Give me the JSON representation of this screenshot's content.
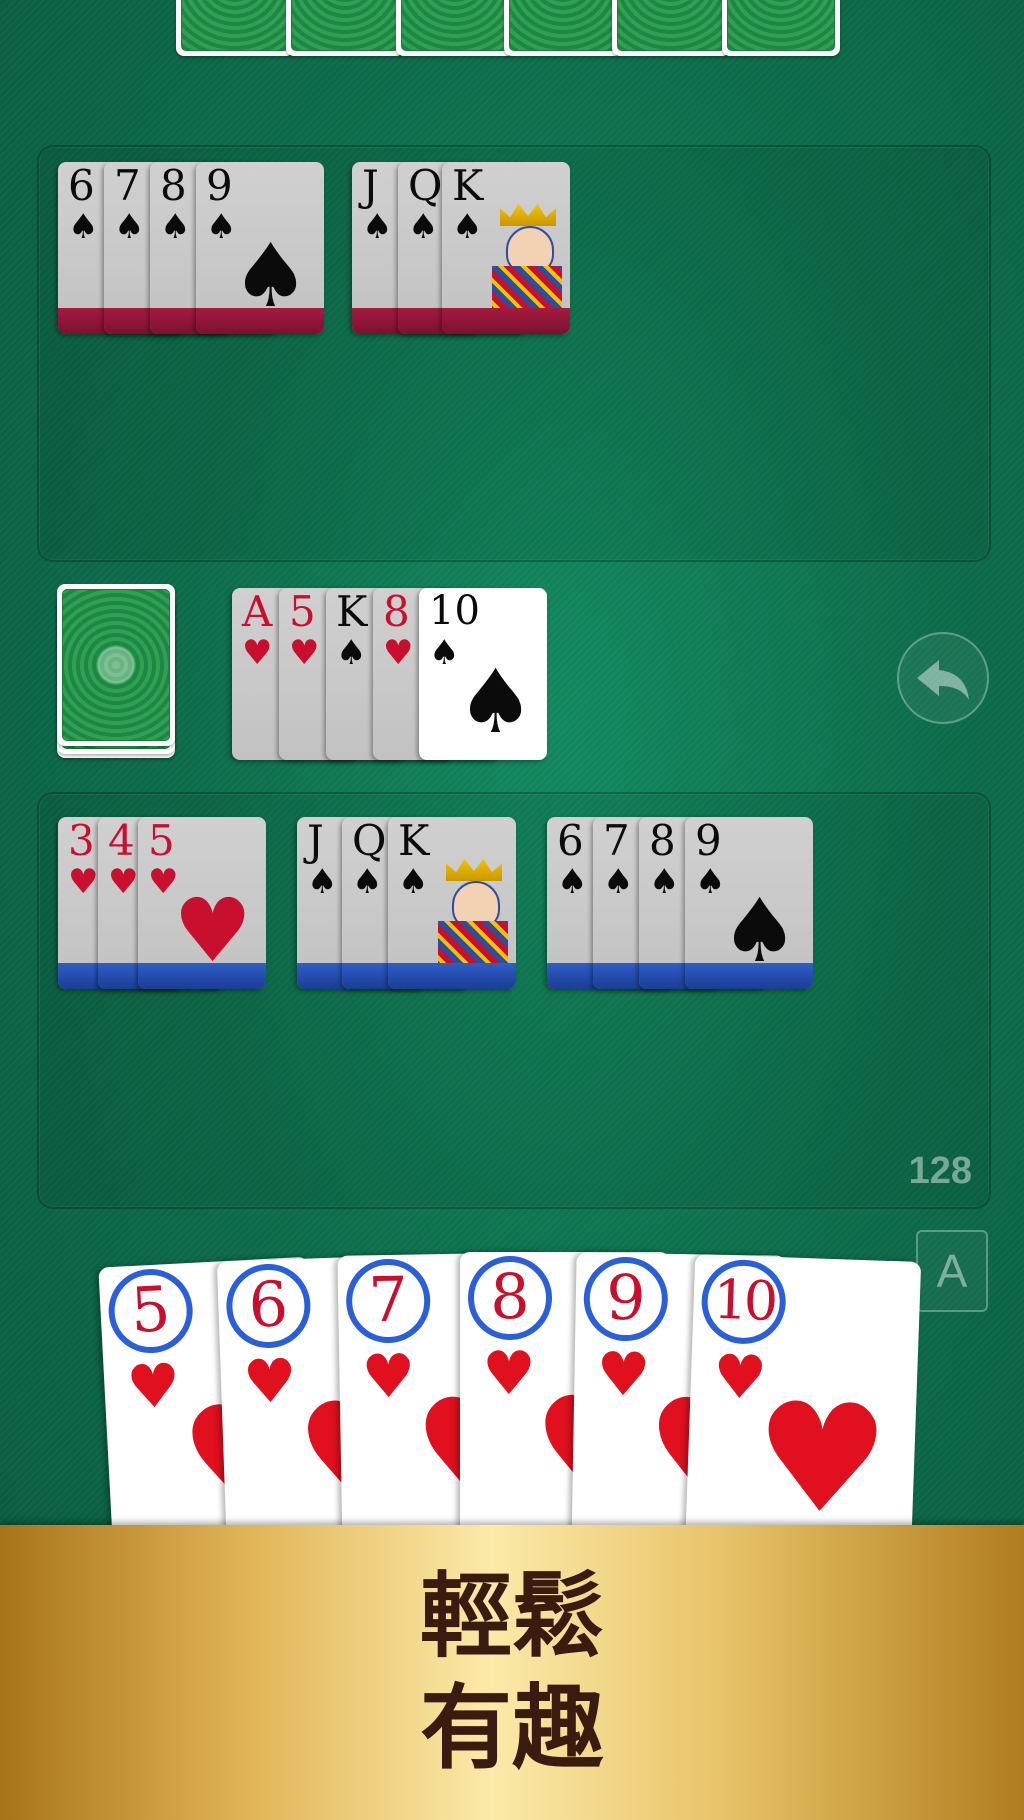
{
  "opponent": {
    "hidden_card_count": 6,
    "melds": [
      {
        "ranks": [
          "6",
          "7",
          "8",
          "9"
        ],
        "suit": "♠",
        "color": "black"
      },
      {
        "ranks": [
          "J",
          "Q",
          "K"
        ],
        "suit": "♠",
        "color": "black"
      }
    ]
  },
  "discard_pile": [
    {
      "rank": "A",
      "suit": "♥",
      "color": "red"
    },
    {
      "rank": "5",
      "suit": "♥",
      "color": "red"
    },
    {
      "rank": "K",
      "suit": "♠",
      "color": "black"
    },
    {
      "rank": "8",
      "suit": "♥",
      "color": "red"
    },
    {
      "rank": "10",
      "suit": "♠",
      "color": "black"
    }
  ],
  "player": {
    "melds": [
      {
        "ranks": [
          "3",
          "4",
          "5"
        ],
        "suit": "♥",
        "color": "red"
      },
      {
        "ranks": [
          "J",
          "Q",
          "K"
        ],
        "suit": "♠",
        "color": "black"
      },
      {
        "ranks": [
          "6",
          "7",
          "8",
          "9"
        ],
        "suit": "♠",
        "color": "black"
      }
    ],
    "score": "128",
    "hand": [
      {
        "rank": "5",
        "suit": "♥"
      },
      {
        "rank": "6",
        "suit": "♥"
      },
      {
        "rank": "7",
        "suit": "♥"
      },
      {
        "rank": "8",
        "suit": "♥"
      },
      {
        "rank": "9",
        "suit": "♥"
      },
      {
        "rank": "10",
        "suit": "♥"
      }
    ]
  },
  "controls": {
    "undo_icon": "undo-arrow-icon",
    "sort_label": "A"
  },
  "banner": {
    "line1": "輕鬆",
    "line2": "有趣"
  },
  "colors": {
    "felt": "#0d6e4c",
    "opponent_stripe": "#8f1638",
    "player_stripe": "#2346a8",
    "hand_circle": "#2b5fd9",
    "heart_red": "#e0101e",
    "banner_text": "#3a1b10"
  }
}
